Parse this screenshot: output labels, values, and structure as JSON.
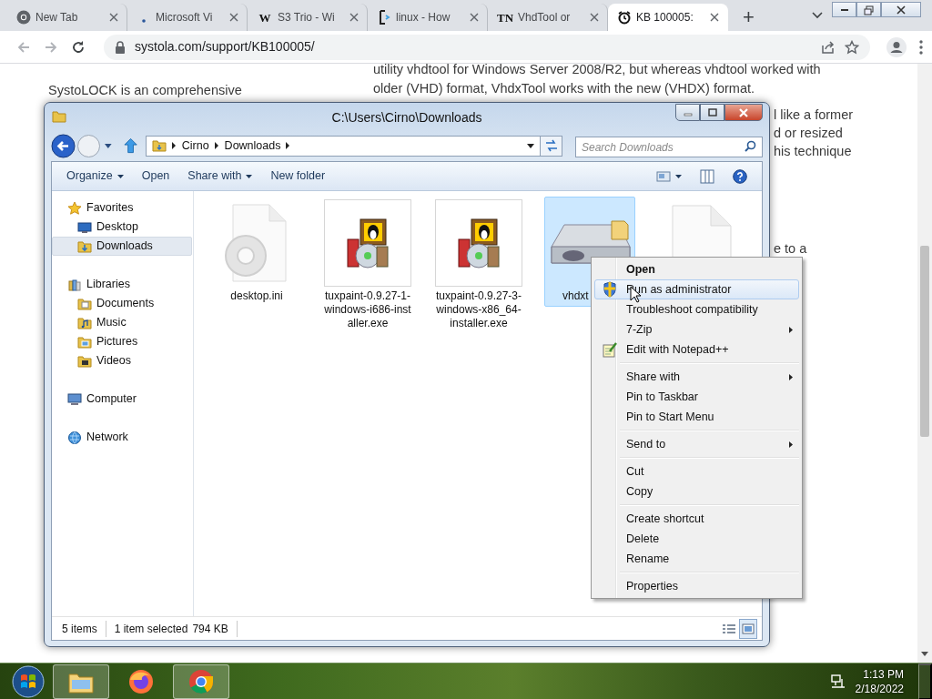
{
  "browser": {
    "tabs": [
      {
        "title": "New Tab",
        "selected": false,
        "kind": "chrome"
      },
      {
        "title": "Microsoft Vi",
        "selected": false,
        "kind": "dot"
      },
      {
        "title": "S3 Trio - Wi",
        "selected": false,
        "kind": "letter",
        "icon_text": "W"
      },
      {
        "title": "linux - How",
        "selected": false,
        "kind": "bracket"
      },
      {
        "title": "VhdTool or",
        "selected": false,
        "kind": "letter",
        "icon_text": "TN"
      },
      {
        "title": "KB 100005:",
        "selected": true,
        "kind": "clock"
      }
    ],
    "new_tab": "+",
    "address": "systola.com/support/KB100005/"
  },
  "web_page": {
    "lead": "SystoLOCK is an comprehensive",
    "paragraph_lines": [
      "utility vhdtool for Windows Server 2008/R2, but whereas vhdtool worked with",
      "older (VHD) format, VhdxTool works with the new (VHDX) format."
    ],
    "fragments": [
      "l like a former",
      "d or resized",
      "his technique",
      "e to a"
    ]
  },
  "explorer": {
    "title": "C:\\Users\\Cirno\\Downloads",
    "breadcrumbs": [
      "Cirno",
      "Downloads"
    ],
    "search_placeholder": "Search Downloads",
    "commands": [
      {
        "label": "Organize",
        "dropdown": true
      },
      {
        "label": "Open",
        "dropdown": false
      },
      {
        "label": "Share with",
        "dropdown": true
      },
      {
        "label": "New folder",
        "dropdown": false
      }
    ],
    "nav": [
      {
        "label": "Favorites",
        "kind": "star",
        "selected": false,
        "children": [
          {
            "label": "Desktop",
            "kind": "desktop",
            "selected": false
          },
          {
            "label": "Downloads",
            "kind": "downloads",
            "selected": true
          }
        ]
      },
      {
        "label": "Libraries",
        "kind": "library",
        "selected": false,
        "children": [
          {
            "label": "Documents",
            "kind": "documents",
            "selected": false
          },
          {
            "label": "Music",
            "kind": "music",
            "selected": false
          },
          {
            "label": "Pictures",
            "kind": "pictures",
            "selected": false
          },
          {
            "label": "Videos",
            "kind": "videos",
            "selected": false
          }
        ]
      },
      {
        "label": "Computer",
        "kind": "computer",
        "selected": false
      },
      {
        "label": "Network",
        "kind": "network",
        "selected": false
      }
    ],
    "files": [
      {
        "name": "desktop.ini",
        "kind": "settings",
        "selected": false
      },
      {
        "name": "tuxpaint-0.9.27-1-windows-i686-installer.exe",
        "kind": "installer",
        "selected": false
      },
      {
        "name": "tuxpaint-0.9.27-3-windows-x86_64-installer.exe",
        "kind": "installer",
        "selected": false
      },
      {
        "name": "vhdxt",
        "kind": "drive",
        "selected": true
      },
      {
        "kind": "blank",
        "selected": false
      }
    ],
    "status": {
      "count": "5 items",
      "selection": "1 item selected",
      "size": "794 KB"
    }
  },
  "context_menu": {
    "groups": [
      [
        {
          "label": "Open",
          "default": true,
          "selected": false,
          "submenu": false
        },
        {
          "label": "Run as administrator",
          "default": false,
          "selected": true,
          "submenu": false
        },
        {
          "label": "Troubleshoot compatibility",
          "default": false,
          "selected": false,
          "submenu": false
        },
        {
          "label": "7-Zip",
          "default": false,
          "selected": false,
          "submenu": true
        },
        {
          "label": "Edit with Notepad++",
          "default": false,
          "selected": false,
          "submenu": false
        }
      ],
      [
        {
          "label": "Share with",
          "default": false,
          "selected": false,
          "submenu": true
        },
        {
          "label": "Pin to Taskbar",
          "default": false,
          "selected": false,
          "submenu": false
        },
        {
          "label": "Pin to Start Menu",
          "default": false,
          "selected": false,
          "submenu": false
        }
      ],
      [
        {
          "label": "Send to",
          "default": false,
          "selected": false,
          "submenu": true
        }
      ],
      [
        {
          "label": "Cut",
          "default": false,
          "selected": false,
          "submenu": false
        },
        {
          "label": "Copy",
          "default": false,
          "selected": false,
          "submenu": false
        }
      ],
      [
        {
          "label": "Create shortcut",
          "default": false,
          "selected": false,
          "submenu": false
        },
        {
          "label": "Delete",
          "default": false,
          "selected": false,
          "submenu": false
        },
        {
          "label": "Rename",
          "default": false,
          "selected": false,
          "submenu": false
        }
      ],
      [
        {
          "label": "Properties",
          "default": false,
          "selected": false,
          "submenu": false
        }
      ]
    ]
  },
  "taskbar": {
    "apps": [
      {
        "kind": "explorer",
        "running": true
      },
      {
        "kind": "firefox",
        "running": false
      },
      {
        "kind": "chrome",
        "running": true
      }
    ],
    "time": "1:13 PM",
    "date": "2/18/2022"
  }
}
